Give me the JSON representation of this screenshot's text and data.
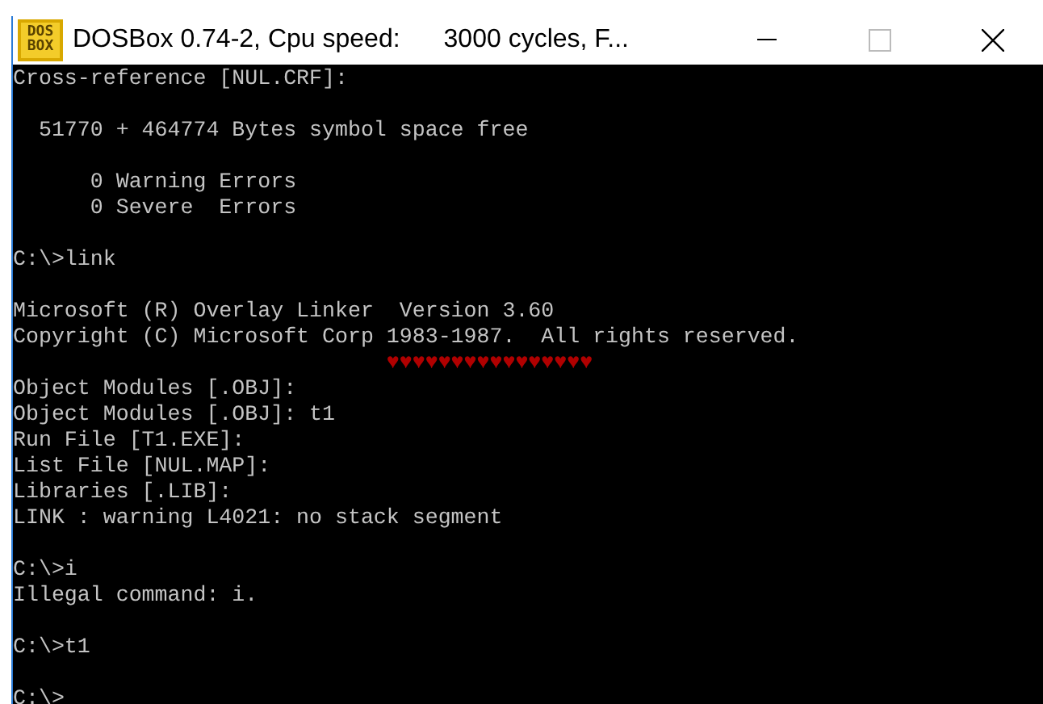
{
  "window": {
    "logo_lines": [
      "DOS",
      "BOX"
    ],
    "title": "DOSBox 0.74-2, Cpu speed:",
    "title_status": "3000 cycles, F..."
  },
  "console": {
    "lines": [
      {
        "kind": "text",
        "text": "Cross-reference [NUL.CRF]:"
      },
      {
        "kind": "blank"
      },
      {
        "kind": "text",
        "text": "  51770 + 464774 Bytes symbol space free"
      },
      {
        "kind": "blank"
      },
      {
        "kind": "text",
        "text": "      0 Warning Errors"
      },
      {
        "kind": "text",
        "text": "      0 Severe  Errors"
      },
      {
        "kind": "blank"
      },
      {
        "kind": "text",
        "text": "C:\\>link"
      },
      {
        "kind": "blank"
      },
      {
        "kind": "text",
        "text": "Microsoft (R) Overlay Linker  Version 3.60"
      },
      {
        "kind": "text",
        "text": "Copyright (C) Microsoft Corp 1983-1987.  All rights reserved."
      },
      {
        "kind": "hearts",
        "text": "                             ♥♥♥♥♥♥♥♥♥♥♥♥♥♥♥♥"
      },
      {
        "kind": "text",
        "text": "Object Modules [.OBJ]:"
      },
      {
        "kind": "text",
        "text": "Object Modules [.OBJ]: t1"
      },
      {
        "kind": "text",
        "text": "Run File [T1.EXE]:"
      },
      {
        "kind": "text",
        "text": "List File [NUL.MAP]:"
      },
      {
        "kind": "text",
        "text": "Libraries [.LIB]:"
      },
      {
        "kind": "text",
        "text": "LINK : warning L4021: no stack segment"
      },
      {
        "kind": "blank"
      },
      {
        "kind": "text",
        "text": "C:\\>i"
      },
      {
        "kind": "text",
        "text": "Illegal command: i."
      },
      {
        "kind": "blank"
      },
      {
        "kind": "text",
        "text": "C:\\>t1"
      },
      {
        "kind": "blank"
      },
      {
        "kind": "text",
        "text": "C:\\>"
      }
    ]
  }
}
